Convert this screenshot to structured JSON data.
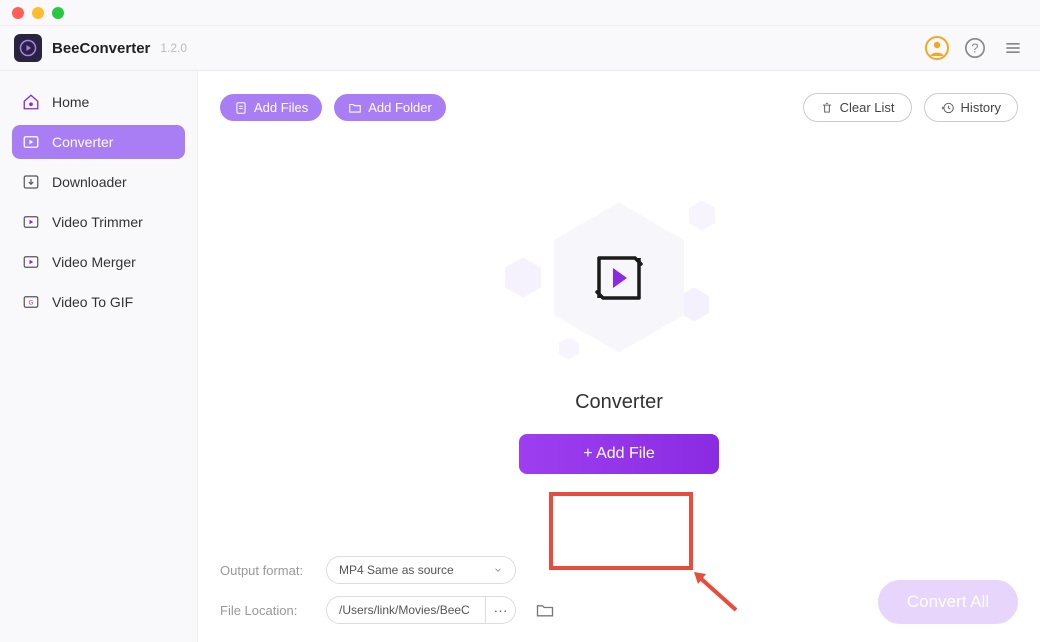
{
  "app": {
    "name": "BeeConverter",
    "version": "1.2.0"
  },
  "sidebar": {
    "items": [
      {
        "label": "Home"
      },
      {
        "label": "Converter"
      },
      {
        "label": "Downloader"
      },
      {
        "label": "Video Trimmer"
      },
      {
        "label": "Video Merger"
      },
      {
        "label": "Video To GIF"
      }
    ],
    "activeIndex": 1
  },
  "toolbar": {
    "addFiles": "Add Files",
    "addFolder": "Add Folder",
    "clearList": "Clear List",
    "history": "History"
  },
  "drop": {
    "title": "Converter",
    "addFile": "+ Add File"
  },
  "footer": {
    "outputFormatLabel": "Output format:",
    "outputFormatValue": "MP4 Same as source",
    "fileLocationLabel": "File Location:",
    "fileLocationValue": "/Users/link/Movies/BeeC",
    "convertAll": "Convert All"
  },
  "colors": {
    "accent": "#a97ef5",
    "primaryBtn": "#8a2be2",
    "highlight": "#e74c3c"
  }
}
